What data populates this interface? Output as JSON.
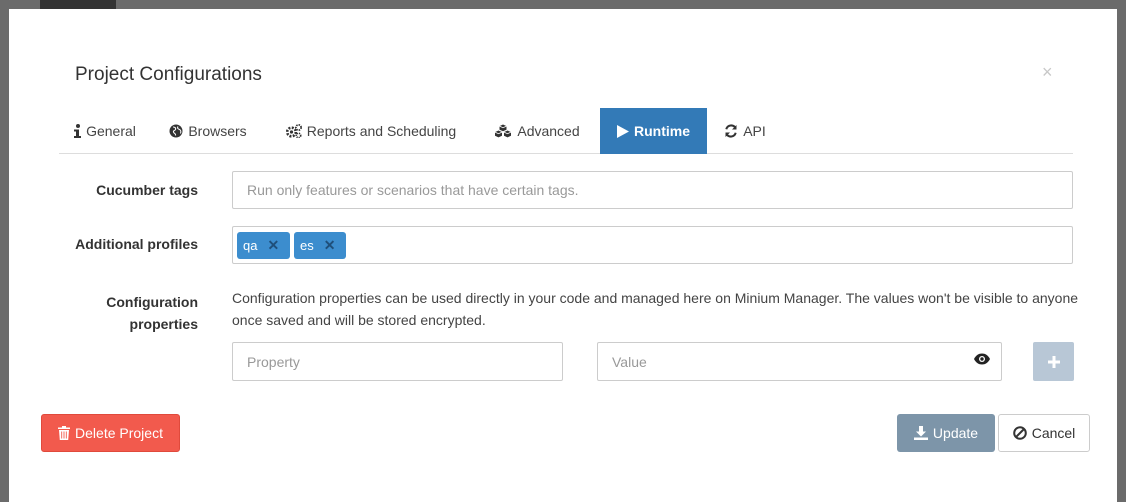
{
  "modal": {
    "title": "Project Configurations",
    "close_label": "×"
  },
  "tabs": [
    {
      "label": "General",
      "icon": "info-icon"
    },
    {
      "label": "Browsers",
      "icon": "globe-icon"
    },
    {
      "label": "Reports and Scheduling",
      "icon": "cogs-icon"
    },
    {
      "label": "Advanced",
      "icon": "cubes-icon"
    },
    {
      "label": "Runtime",
      "icon": "play-icon",
      "active": true
    },
    {
      "label": "API",
      "icon": "refresh-icon"
    }
  ],
  "form": {
    "cucumber_tags_label": "Cucumber tags",
    "cucumber_tags_placeholder": "Run only features or scenarios that have certain tags.",
    "additional_profiles_label": "Additional profiles",
    "profiles": [
      "qa",
      "es"
    ],
    "config_label_line1": "Configuration",
    "config_label_line2": "properties",
    "config_description": "Configuration properties can be used directly in your code and managed here on Minium Manager. The values won't be visible to anyone once saved and will be stored encrypted.",
    "property_placeholder": "Property",
    "value_placeholder": "Value"
  },
  "footer": {
    "delete_label": "Delete Project",
    "update_label": "Update",
    "cancel_label": "Cancel"
  },
  "colors": {
    "primary": "#337ab7",
    "danger": "#f25a4d",
    "update": "#7d95a9",
    "tag": "#3c8dce"
  }
}
